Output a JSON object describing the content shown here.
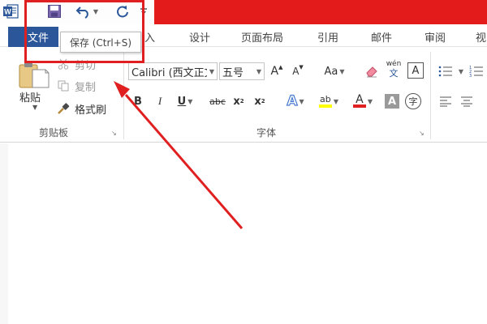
{
  "app": {
    "logo_text": "W",
    "accent_color": "#e41b1b",
    "file_tab_color": "#2b579a"
  },
  "quick_access": {
    "save_icon": "save-icon",
    "undo_icon": "undo-icon",
    "redo_icon": "redo-icon",
    "customize_icon": "customize-qat-icon"
  },
  "tooltip": {
    "text": "保存 (Ctrl+S)"
  },
  "tabs": {
    "file": "文件",
    "insert_partial": "入",
    "design": "设计",
    "layout": "页面布局",
    "references": "引用",
    "mailings": "邮件",
    "review": "审阅",
    "view_partial": "视"
  },
  "clipboard": {
    "paste": "粘贴",
    "cut": "剪切",
    "copy": "复制",
    "format_painter": "格式刷",
    "group_label": "剪贴板"
  },
  "font": {
    "name": "Calibri (西文正文)",
    "size": "五号",
    "grow": "A",
    "shrink": "A",
    "change_case": "Aa",
    "phonetic_top": "wén",
    "phonetic_bottom": "文",
    "char_border": "A",
    "bold": "B",
    "italic": "I",
    "underline": "U",
    "strikethrough": "abc",
    "subscript": "x",
    "subscript_mark": "2",
    "superscript": "x",
    "superscript_mark": "2",
    "text_effects": "A",
    "highlight": "ab",
    "font_color": "A",
    "char_shading": "A",
    "enclose_char": "字",
    "group_label": "字体"
  },
  "paragraph": {
    "bullets_icon": "bullets-icon",
    "numbering_icon": "numbering-icon",
    "align_left_icon": "align-left-icon",
    "center_icon": "center-icon"
  },
  "annotation": {
    "color": "#e02020"
  }
}
